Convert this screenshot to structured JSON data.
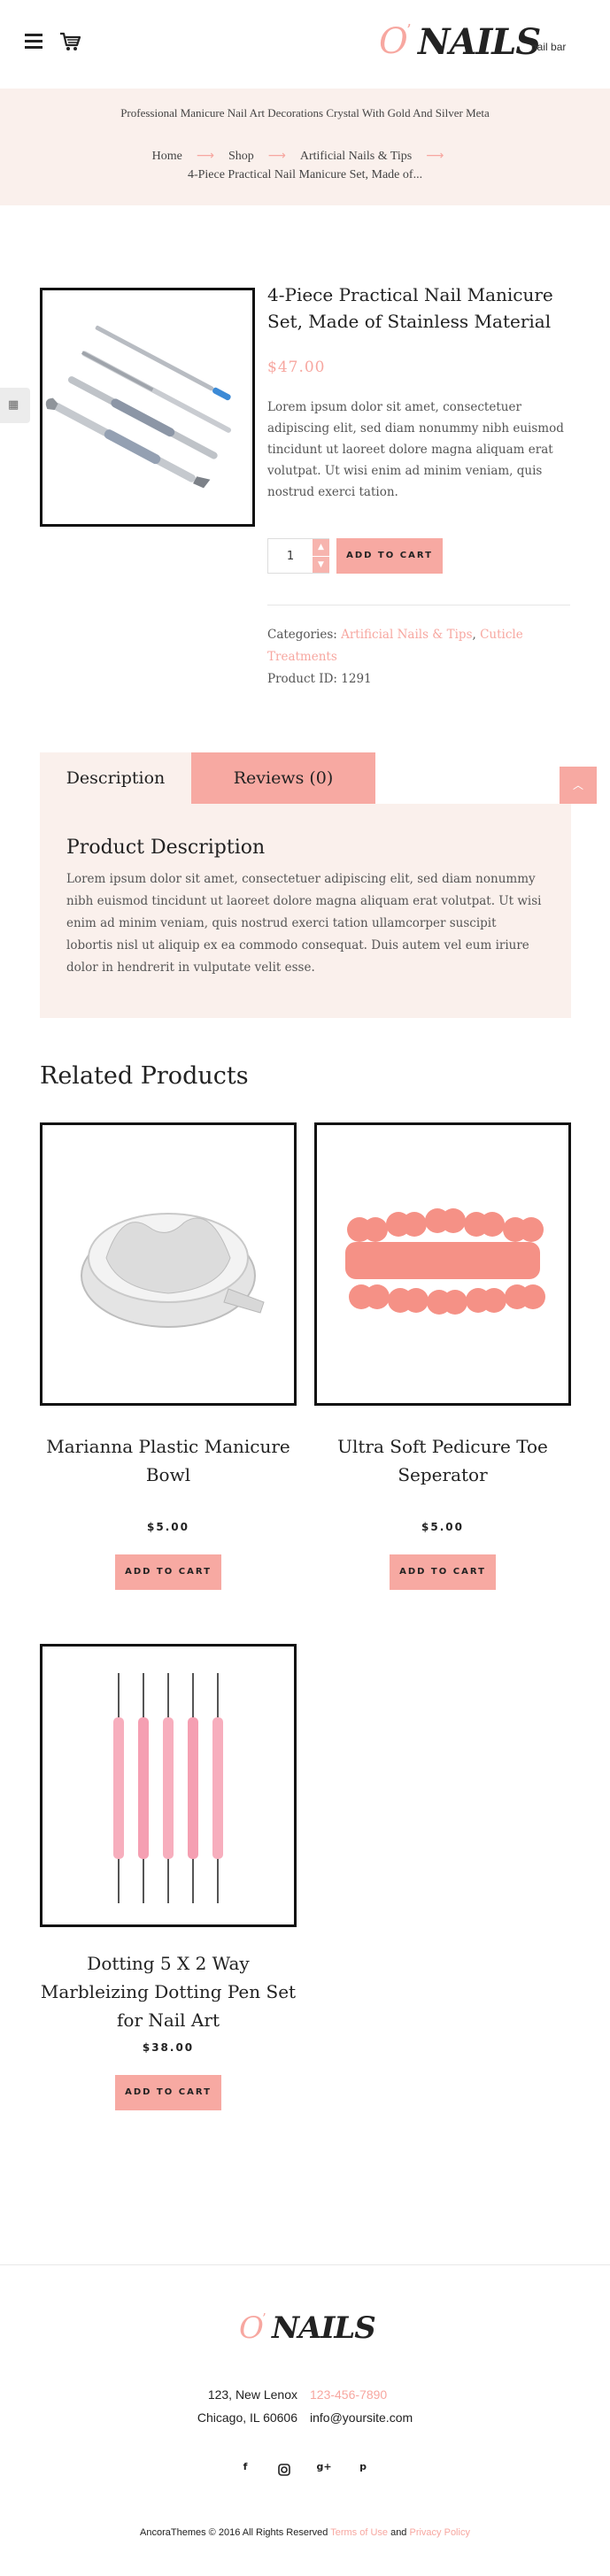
{
  "header": {
    "logo_letter": "O",
    "logo_mark": "’",
    "logo_word": "NAILS",
    "logo_sub": "nail bar"
  },
  "banner": {
    "title": "Professional Manicure Nail Art Decorations Crystal With Gold And Silver Meta",
    "breadcrumb": [
      "Home",
      "Shop",
      "Artificial Nails & Tips"
    ],
    "arrow": "⟶",
    "current": "4-Piece Practical Nail Manicure Set, Made of..."
  },
  "product": {
    "title": "4-Piece Practical Nail Manicure Set, Made of Stainless Material",
    "price": "$47.00",
    "description": "Lorem ipsum dolor sit amet, consectetuer adipiscing elit, sed diam nonummy nibh euismod tincidunt ut laoreet dolore magna aliquam erat volutpat. Ut wisi enim ad minim veniam, quis nostrud exerci tation.",
    "quantity": "1",
    "add_to_cart": "ADD TO CART",
    "categories_label": "Categories: ",
    "category_1": "Artificial Nails & Tips",
    "category_sep": ", ",
    "category_2": "Cuticle Treatments",
    "product_id": "Product ID: 1291"
  },
  "tabs": {
    "description": "Description",
    "reviews": "Reviews (0)",
    "panel_title": "Product Description",
    "panel_text": "Lorem ipsum dolor sit amet, consectetuer adipiscing elit, sed diam nonummy nibh euismod tincidunt ut laoreet dolore magna aliquam erat volutpat. Ut wisi enim ad minim veniam, quis nostrud exerci tation ullamcorper suscipit lobortis nisl ut aliquip ex ea commodo consequat. Duis autem vel eum iriure dolor in hendrerit in vulputate velit esse."
  },
  "related": {
    "title": "Related Products",
    "items": [
      {
        "name": "Marianna Plastic Manicure Bowl",
        "price": "$5.00",
        "button": "ADD TO CART"
      },
      {
        "name": "Ultra Soft Pedicure Toe Seperator",
        "price": "$5.00",
        "button": "ADD TO CART"
      },
      {
        "name": "Dotting 5 X 2 Way Marbleizing Dotting Pen Set for Nail Art",
        "price": "$38.00",
        "button": "ADD TO CART"
      }
    ]
  },
  "footer": {
    "logo_letter": "O",
    "logo_mark": "’",
    "logo_word": "NAILS",
    "address_1": "123, New Lenox",
    "phone": "123-456-7890",
    "address_2": "Chicago, IL 60606",
    "email": "info@yoursite.com",
    "social": [
      "f",
      "g+",
      "p"
    ],
    "copyright": "AncoraThemes © 2016 All Rights Reserved ",
    "terms": "Terms of Use",
    "and": " and ",
    "privacy": "Privacy Policy"
  },
  "colors": {
    "accent": "#f7a9a2",
    "banner_bg": "#faf0ec",
    "text": "#333333"
  }
}
